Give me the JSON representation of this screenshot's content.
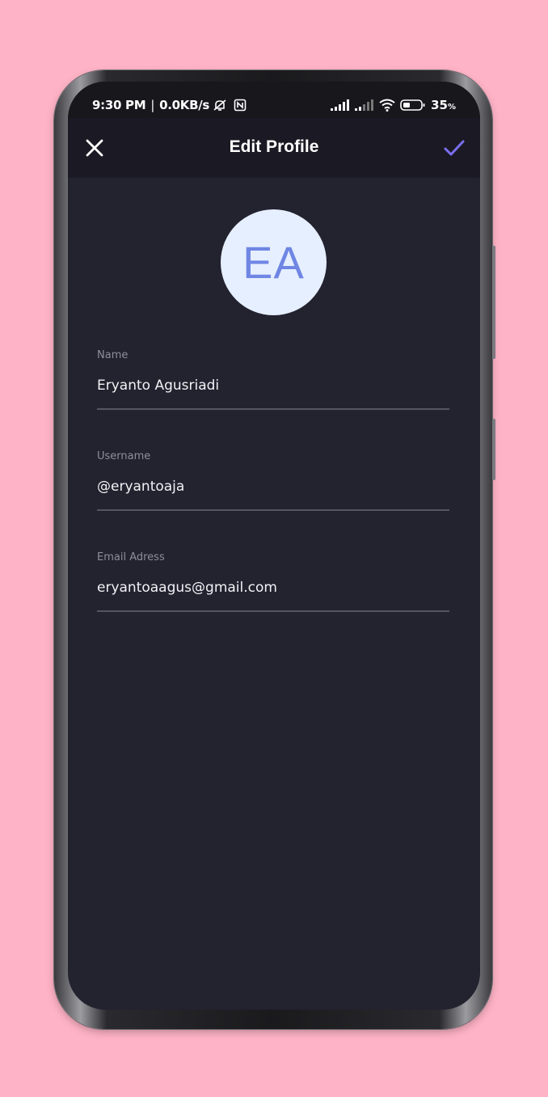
{
  "status_bar": {
    "time": "9:30 PM",
    "separator": "|",
    "speed": "0.0KB/s",
    "battery": "35",
    "battery_unit": "%"
  },
  "app_bar": {
    "title": "Edit Profile"
  },
  "avatar": {
    "initials": "EA"
  },
  "fields": [
    {
      "label": "Name",
      "value": "Eryanto Agusriadi"
    },
    {
      "label": "Username",
      "value": "@eryantoaja"
    },
    {
      "label": "Email Adress",
      "value": "eryantoaagus@gmail.com"
    }
  ],
  "colors": {
    "background": "#ffb3c6",
    "screen": "#23222f",
    "app_bar": "#1b1a24",
    "accent": "#7b6ef0",
    "avatar_bg": "#e6efff",
    "avatar_text": "#6f86e3"
  },
  "icons": {
    "close": "close-icon",
    "confirm": "check-icon",
    "wifi": "wifi-icon",
    "battery": "battery-icon",
    "signal": "signal-icon",
    "mute": "notifications-off-icon",
    "nfc": "nfc-icon"
  }
}
